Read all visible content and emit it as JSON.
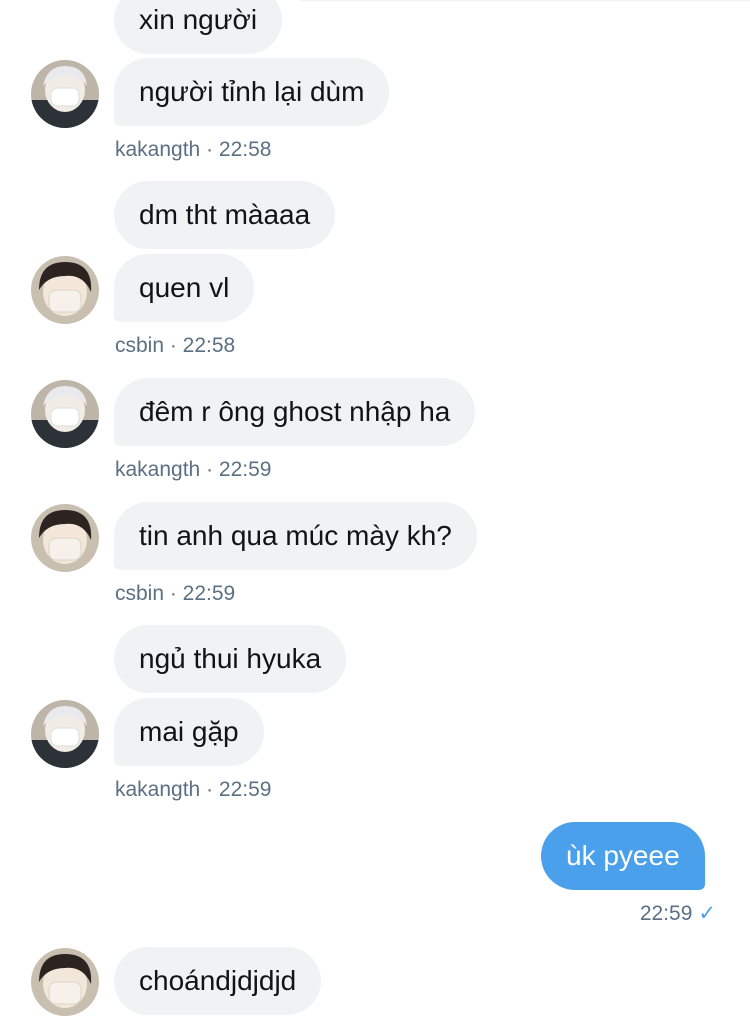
{
  "messages": [
    {
      "text": "xin người"
    },
    {
      "text": "người tỉnh lại dùm"
    },
    {
      "text": "dm tht màaaa"
    },
    {
      "text": "quen vl"
    },
    {
      "text": "đêm r ông ghost nhập ha"
    },
    {
      "text": "tin anh qua múc mày kh?"
    },
    {
      "text": "ngủ thui hyuka"
    },
    {
      "text": "mai gặp"
    },
    {
      "text": "ùk pyeee"
    },
    {
      "text": "choándjdjdjd"
    }
  ],
  "meta": [
    {
      "text": "kakangth · 22:58"
    },
    {
      "text": "csbin · 22:58"
    },
    {
      "text": "kakangth · 22:59"
    },
    {
      "text": "csbin · 22:59"
    },
    {
      "text": "kakangth · 22:59"
    },
    {
      "time": "22:59",
      "status_icon": "checkmark-icon"
    }
  ],
  "avatars": {
    "kakangth": {
      "description_icon": "avatar-light-hair-mask",
      "bg": "#d9d3c8",
      "hair": "#e8e8ec"
    },
    "csbin": {
      "description_icon": "avatar-dark-hair-mask",
      "bg": "#cfc4b3",
      "hair": "#2b2420"
    }
  },
  "colors": {
    "incoming_bubble": "#eff3f4",
    "outgoing_bubble": "#4aa0ea",
    "meta_text": "#5b7083",
    "check": "#4aa0ea"
  }
}
